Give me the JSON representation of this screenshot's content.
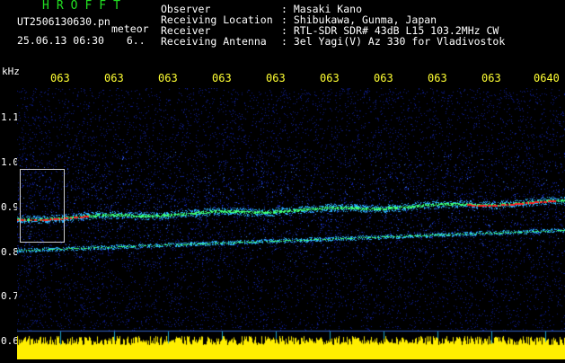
{
  "header": {
    "app_title": "HROFFT",
    "filename": "UT2506130630.pn",
    "filename_suffix": "meteor",
    "datetime": "25.06.13 06:30",
    "datetime_suffix": "6..",
    "info": [
      {
        "label": "Observer",
        "value": ": Masaki Kano"
      },
      {
        "label": "Receiving Location",
        "value": ": Shibukawa, Gunma, Japan"
      },
      {
        "label": "Receiver",
        "value": ": RTL-SDR SDR# 43dB L15 103.2MHz CW"
      },
      {
        "label": "Receiving Antenna",
        "value": ": 3el Yagi(V) Az 330 for Vladivostok"
      }
    ]
  },
  "spectrogram": {
    "unit": "kHz",
    "time_labels": [
      "063",
      "063",
      "063",
      "063",
      "063",
      "063",
      "063",
      "063",
      "063",
      "0640"
    ],
    "freq_labels": [
      "1.1",
      "1.0",
      "0.9",
      "0.8",
      "0.7",
      "0.6"
    ],
    "colors": {
      "background": "#000000",
      "noise": "#1a2fd8",
      "band": "#2a5cff",
      "line_green": "#3cff7a",
      "line_red": "#ff2020",
      "amplitude": "#ffee00",
      "grid": "#cccccc"
    }
  }
}
